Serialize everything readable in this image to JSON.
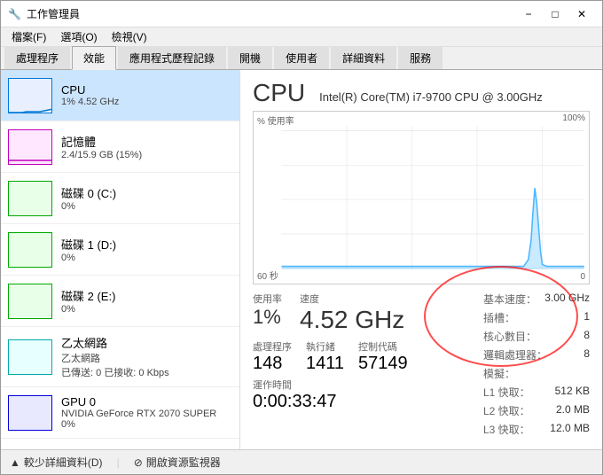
{
  "window": {
    "title": "工作管理員",
    "icon": "⚙"
  },
  "menu": {
    "items": [
      "檔案(F)",
      "選項(O)",
      "檢視(V)"
    ]
  },
  "tabs": [
    {
      "label": "處理程序",
      "active": false
    },
    {
      "label": "效能",
      "active": true
    },
    {
      "label": "應用程式歷程記錄",
      "active": false
    },
    {
      "label": "開機",
      "active": false
    },
    {
      "label": "使用者",
      "active": false
    },
    {
      "label": "詳細資料",
      "active": false
    },
    {
      "label": "服務",
      "active": false
    }
  ],
  "sidebar": {
    "items": [
      {
        "id": "cpu",
        "name": "CPU",
        "detail": "1% 4.52 GHz",
        "usage": "",
        "active": true,
        "border_color": "#0078d7"
      },
      {
        "id": "memory",
        "name": "記憶體",
        "detail": "2.4/15.9 GB (15%)",
        "usage": "",
        "active": false,
        "border_color": "#c000c0"
      },
      {
        "id": "disk0",
        "name": "磁碟 0 (C:)",
        "detail": "0%",
        "usage": "",
        "active": false,
        "border_color": "#00aa00"
      },
      {
        "id": "disk1",
        "name": "磁碟 1 (D:)",
        "detail": "0%",
        "usage": "",
        "active": false,
        "border_color": "#00aa00"
      },
      {
        "id": "disk2",
        "name": "磁碟 2 (E:)",
        "detail": "0%",
        "usage": "",
        "active": false,
        "border_color": "#00aa00"
      },
      {
        "id": "network",
        "name": "乙太網路",
        "detail": "乙太網路",
        "usage": "已傳送: 0 已接收: 0 Kbps",
        "active": false,
        "border_color": "#00aaaa"
      },
      {
        "id": "gpu",
        "name": "GPU 0",
        "detail": "NVIDIA GeForce RTX 2070 SUPER",
        "usage": "0%",
        "active": false,
        "border_color": "#0000dd"
      }
    ]
  },
  "main": {
    "title": "CPU",
    "subtitle": "Intel(R) Core(TM) i7-9700 CPU @ 3.00GHz",
    "chart": {
      "y_label_top": "% 使用率",
      "y_label_top_right": "100%",
      "x_label_bottom": "60 秒",
      "x_label_bottom_right": "0"
    },
    "usage_label": "使用率",
    "speed_label": "速度",
    "usage_value": "1%",
    "speed_value": "4.52 GHz",
    "process_label": "處理程序",
    "thread_label": "執行緒",
    "handle_label": "控制代碼",
    "process_value": "148",
    "thread_value": "1411",
    "handle_value": "57149",
    "uptime_label": "運作時間",
    "uptime_value": "0:00:33:47",
    "specs": [
      {
        "label": "基本速度：",
        "value": "3.00 GHz"
      },
      {
        "label": "插槽：",
        "value": "1"
      },
      {
        "label": "核心數目：",
        "value": "8"
      },
      {
        "label": "邏輯處理器：",
        "value": "8"
      },
      {
        "label": "模擬：",
        "value": ""
      },
      {
        "label": "L1 快取：",
        "value": "512 KB"
      },
      {
        "label": "L2 快取：",
        "value": "2.0 MB"
      },
      {
        "label": "L3 快取：",
        "value": "12.0 MB"
      }
    ]
  },
  "bottom_bar": {
    "less_detail": "較少詳細資料(D)",
    "open_monitor": "開啟資源監視器"
  },
  "colors": {
    "accent": "#0078d7",
    "active_bg": "#cce5ff",
    "chart_line": "#4db8ff",
    "chart_spike": "#0078d7"
  }
}
